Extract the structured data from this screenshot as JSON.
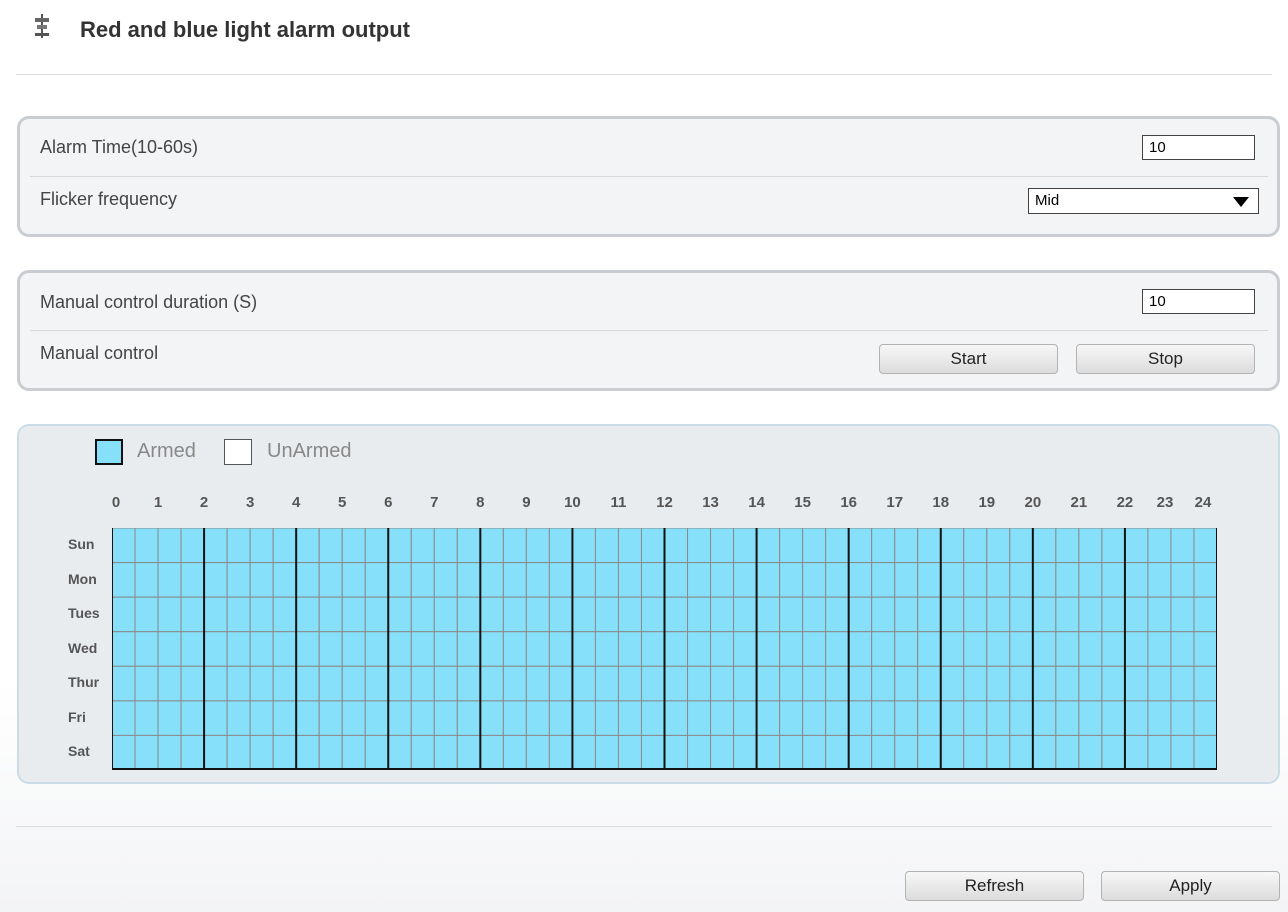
{
  "header": {
    "title": "Red and blue light alarm output",
    "icon": "alarm-light-icon"
  },
  "alarm_settings": {
    "alarm_time_label": "Alarm Time(10-60s)",
    "alarm_time_value": "10",
    "flicker_label": "Flicker frequency",
    "flicker_value": "Mid"
  },
  "manual": {
    "duration_label": "Manual control duration (S)",
    "duration_value": "10",
    "control_label": "Manual control",
    "start_label": "Start",
    "stop_label": "Stop"
  },
  "schedule": {
    "legend": {
      "armed": "Armed",
      "unarmed": "UnArmed"
    },
    "hours": [
      "0",
      "1",
      "2",
      "3",
      "4",
      "5",
      "6",
      "7",
      "8",
      "9",
      "10",
      "11",
      "12",
      "13",
      "14",
      "15",
      "16",
      "17",
      "18",
      "19",
      "20",
      "21",
      "22",
      "23",
      "24"
    ],
    "days": [
      "Sun",
      "Mon",
      "Tues",
      "Wed",
      "Thur",
      "Fri",
      "Sat"
    ],
    "all_armed": true,
    "colors": {
      "armed": "#86e0f9",
      "unarmed": "#ffffff"
    }
  },
  "footer": {
    "refresh_label": "Refresh",
    "apply_label": "Apply"
  }
}
